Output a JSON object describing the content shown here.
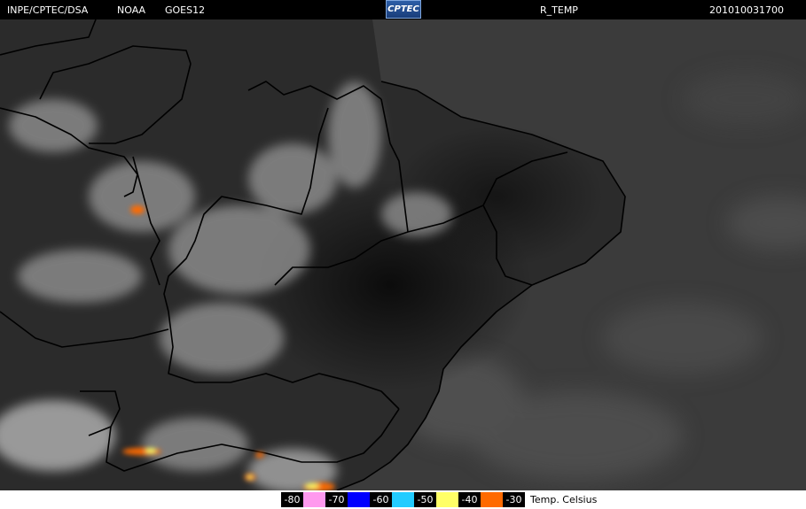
{
  "header": {
    "source": "INPE/CPTEC/DSA",
    "agency": "NOAA",
    "satellite": "GOES12",
    "logo_text": "CPTEC",
    "product": "R_TEMP",
    "timestamp": "201010031700"
  },
  "legend": {
    "unit": "Temp. Celsius",
    "entries": [
      {
        "label": "-80",
        "color": "#ff99ee"
      },
      {
        "label": "-70",
        "color": "#0000ff"
      },
      {
        "label": "-60",
        "color": "#22ccff"
      },
      {
        "label": "-50",
        "color": "#ffff66"
      },
      {
        "label": "-40",
        "color": "#ff6a00"
      },
      {
        "label": "-30",
        "color": ""
      }
    ]
  },
  "colors": {
    "ocean": "#3b3b3b",
    "land": "#2a2a2a",
    "cloud": "#bdbdbd",
    "border": "#000000",
    "cold_top_orange": "#ff6a00",
    "cold_top_yellow": "#ffff66"
  }
}
